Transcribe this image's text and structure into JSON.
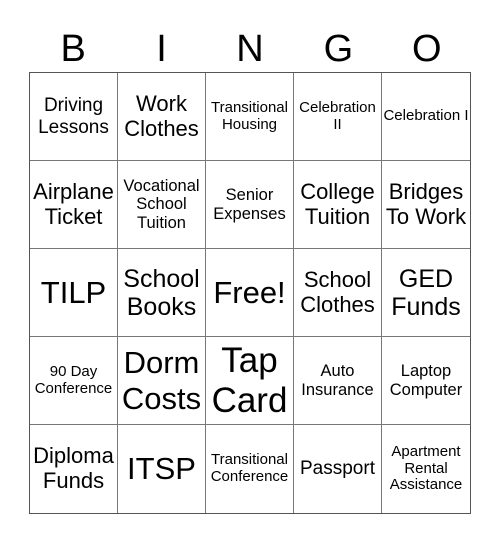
{
  "header": [
    "B",
    "I",
    "N",
    "G",
    "O"
  ],
  "cells": [
    "Driving Lessons",
    "Work Clothes",
    "Transitional Housing",
    "Celebration II",
    "Celebration I",
    "Airplane Ticket",
    "Vocational School Tuition",
    "Senior Expenses",
    "College Tuition",
    "Bridges To Work",
    "TILP",
    "School Books",
    "Free!",
    "School Clothes",
    "GED Funds",
    "90 Day Conference",
    "Dorm Costs",
    "Tap Card",
    "Auto Insurance",
    "Laptop Computer",
    "Diploma Funds",
    "ITSP",
    "Transitional Conference",
    "Passport",
    "Apartment Rental Assistance"
  ]
}
